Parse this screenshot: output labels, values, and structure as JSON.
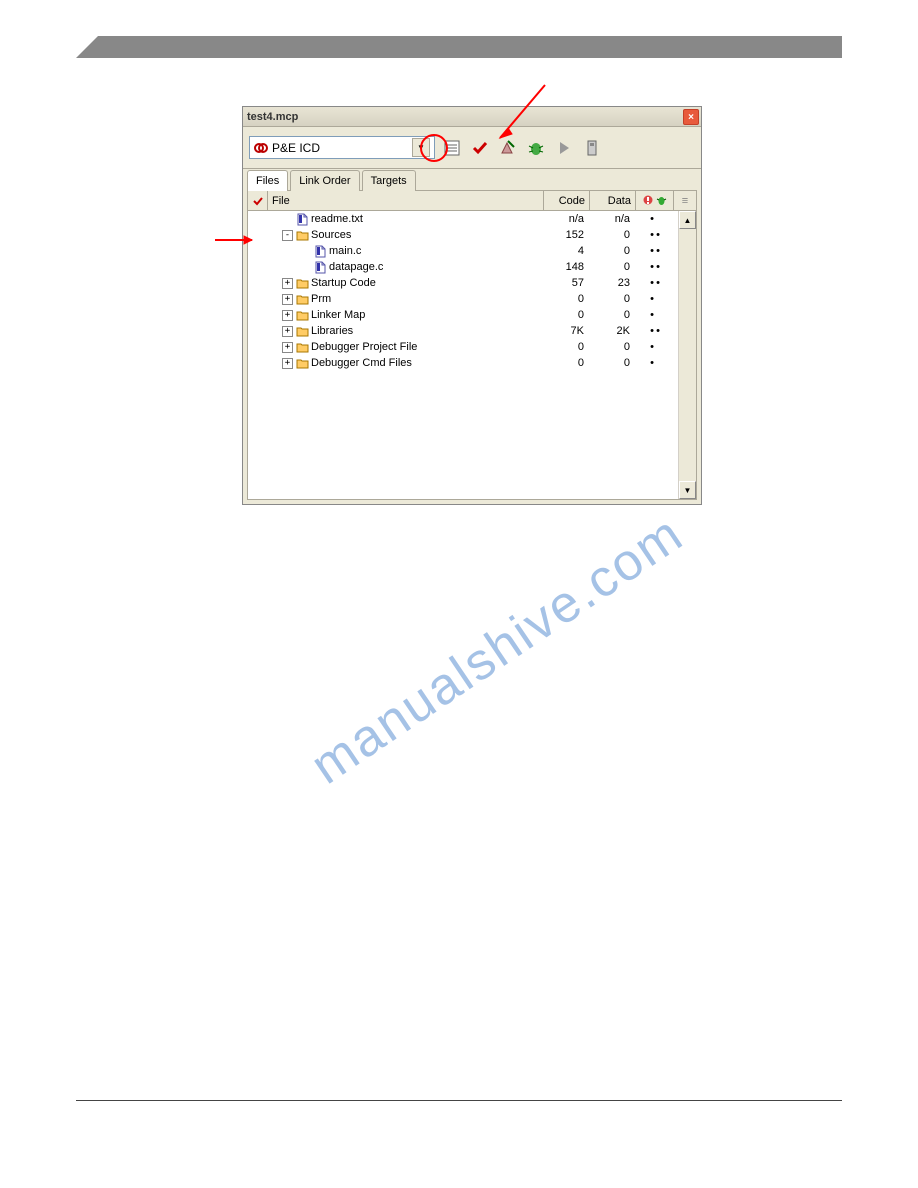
{
  "window": {
    "title": "test4.mcp",
    "target": "P&E ICD"
  },
  "tabs": [
    {
      "label": "Files",
      "active": true
    },
    {
      "label": "Link Order",
      "active": false
    },
    {
      "label": "Targets",
      "active": false
    }
  ],
  "columns": {
    "file": "File",
    "code": "Code",
    "data": "Data"
  },
  "rows": [
    {
      "indent": 0,
      "tree": "",
      "type": "doc",
      "name": "readme.txt",
      "code": "n/a",
      "data": "n/a",
      "d1": "•",
      "d2": "",
      "thumb": true
    },
    {
      "indent": 0,
      "tree": "-",
      "type": "folder",
      "name": "Sources",
      "code": "152",
      "data": "0",
      "d1": "•",
      "d2": "•",
      "thumb": true
    },
    {
      "indent": 1,
      "tree": "",
      "type": "doc",
      "name": "main.c",
      "code": "4",
      "data": "0",
      "d1": "•",
      "d2": "•",
      "thumb": true
    },
    {
      "indent": 1,
      "tree": "",
      "type": "doc",
      "name": "datapage.c",
      "code": "148",
      "data": "0",
      "d1": "•",
      "d2": "•",
      "thumb": true
    },
    {
      "indent": 0,
      "tree": "+",
      "type": "folder",
      "name": "Startup Code",
      "code": "57",
      "data": "23",
      "d1": "•",
      "d2": "•",
      "thumb": true
    },
    {
      "indent": 0,
      "tree": "+",
      "type": "folder",
      "name": "Prm",
      "code": "0",
      "data": "0",
      "d1": "•",
      "d2": "",
      "thumb": true
    },
    {
      "indent": 0,
      "tree": "+",
      "type": "folder",
      "name": "Linker Map",
      "code": "0",
      "data": "0",
      "d1": "•",
      "d2": "",
      "thumb": true
    },
    {
      "indent": 0,
      "tree": "+",
      "type": "folder",
      "name": "Libraries",
      "code": "7K",
      "data": "2K",
      "d1": "•",
      "d2": "•",
      "thumb": true
    },
    {
      "indent": 0,
      "tree": "+",
      "type": "folder",
      "name": "Debugger Project File",
      "code": "0",
      "data": "0",
      "d1": "•",
      "d2": "",
      "thumb": true
    },
    {
      "indent": 0,
      "tree": "+",
      "type": "folder",
      "name": "Debugger Cmd Files",
      "code": "0",
      "data": "0",
      "d1": "•",
      "d2": "",
      "thumb": true
    }
  ],
  "watermark": "manualshive.com"
}
